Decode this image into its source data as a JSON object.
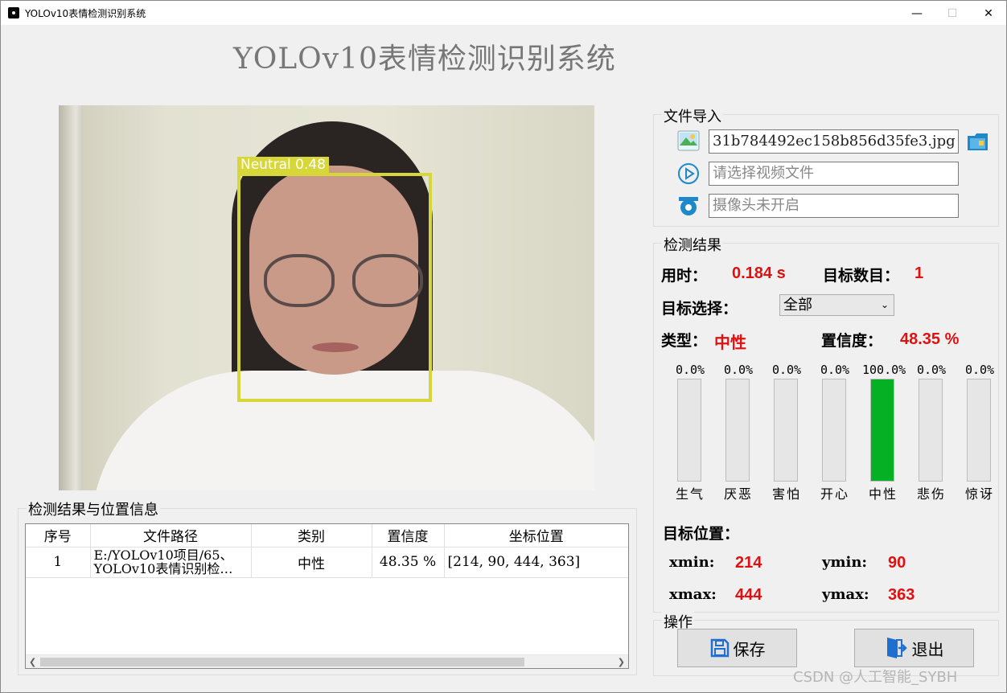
{
  "window": {
    "title": "YOLOv10表情检测识别系统"
  },
  "header": {
    "title": "YOLOv10表情检测识别系统"
  },
  "photo": {
    "bbox_label": "Neutral 0.48"
  },
  "file_import": {
    "title": "文件导入",
    "image_path": "31b784492ec158b856d35fe3.jpg",
    "video_placeholder": "请选择视频文件",
    "camera_status": "摄像头未开启"
  },
  "result": {
    "title": "检测结果",
    "time_label": "用时：",
    "time_value": "0.184 s",
    "count_label": "目标数目：",
    "count_value": "1",
    "select_label": "目标选择：",
    "select_value": "全部",
    "type_label": "类型：",
    "type_value": "中性",
    "conf_label": "置信度：",
    "conf_value": "48.35 %",
    "bars": [
      {
        "name": "生气",
        "pct": "0.0%",
        "value": 0
      },
      {
        "name": "厌恶",
        "pct": "0.0%",
        "value": 0
      },
      {
        "name": "害怕",
        "pct": "0.0%",
        "value": 0
      },
      {
        "name": "开心",
        "pct": "0.0%",
        "value": 0
      },
      {
        "name": "中性",
        "pct": "100.0%",
        "value": 100
      },
      {
        "name": "悲伤",
        "pct": "0.0%",
        "value": 0
      },
      {
        "name": "惊讶",
        "pct": "0.0%",
        "value": 0
      }
    ],
    "bar_color": "#06b025",
    "position_label": "目标位置：",
    "xmin_label": "xmin:",
    "xmin": "214",
    "ymin_label": "ymin:",
    "ymin": "90",
    "xmax_label": "xmax:",
    "xmax": "444",
    "ymax_label": "ymax:",
    "ymax": "363"
  },
  "ops": {
    "title": "操作",
    "save_label": "保存",
    "exit_label": "退出"
  },
  "table": {
    "title": "检测结果与位置信息",
    "headers": [
      "序号",
      "文件路径",
      "类别",
      "置信度",
      "坐标位置"
    ],
    "rows": [
      {
        "idx": "1",
        "path_line1": "E:/YOLOv10项目/65、",
        "path_line2": "YOLOv10表情识别检…",
        "cls": "中性",
        "conf": "48.35 %",
        "coord": "[214, 90, 444, 363]"
      }
    ]
  },
  "watermark": "CSDN @人工智能_SYBH",
  "accent_red": "#e01010"
}
